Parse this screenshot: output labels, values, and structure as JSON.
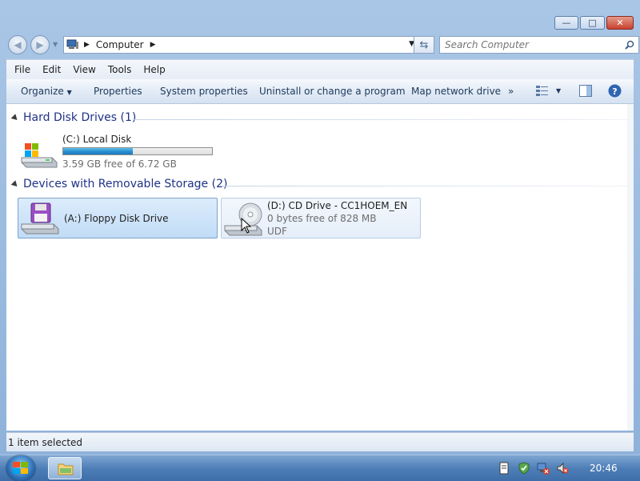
{
  "window": {
    "controls": {
      "minimize": "—",
      "maximize": "□",
      "close": "✕"
    }
  },
  "navigation": {
    "back_icon": "arrow-left-icon",
    "forward_icon": "arrow-right-icon",
    "address_crumb": "Computer",
    "search_placeholder": "Search Computer"
  },
  "menu": {
    "items": [
      "File",
      "Edit",
      "View",
      "Tools",
      "Help"
    ]
  },
  "toolbar": {
    "organize": "Organize",
    "properties": "Properties",
    "system_properties": "System properties",
    "uninstall": "Uninstall or change a program",
    "map_drive": "Map network drive",
    "more": "»"
  },
  "groups": [
    {
      "title": "Hard Disk Drives (1)",
      "items": [
        {
          "name": "(C:) Local Disk",
          "space": "3.59 GB free of 6.72 GB",
          "used_fraction": 0.47
        }
      ]
    },
    {
      "title": "Devices with Removable Storage (2)",
      "items": [
        {
          "name": "(A:) Floppy Disk Drive",
          "selected": true
        },
        {
          "name": "(D:) CD Drive - CC1HOEM_EN",
          "space": "0 bytes free of 828 MB",
          "fs": "UDF"
        }
      ]
    }
  ],
  "status": {
    "text": "1 item selected"
  },
  "taskbar": {
    "clock": "20:46"
  },
  "colors": {
    "accent": "#1e3287",
    "progress": "#2b8fd1",
    "selection": "#c1dcf6"
  }
}
